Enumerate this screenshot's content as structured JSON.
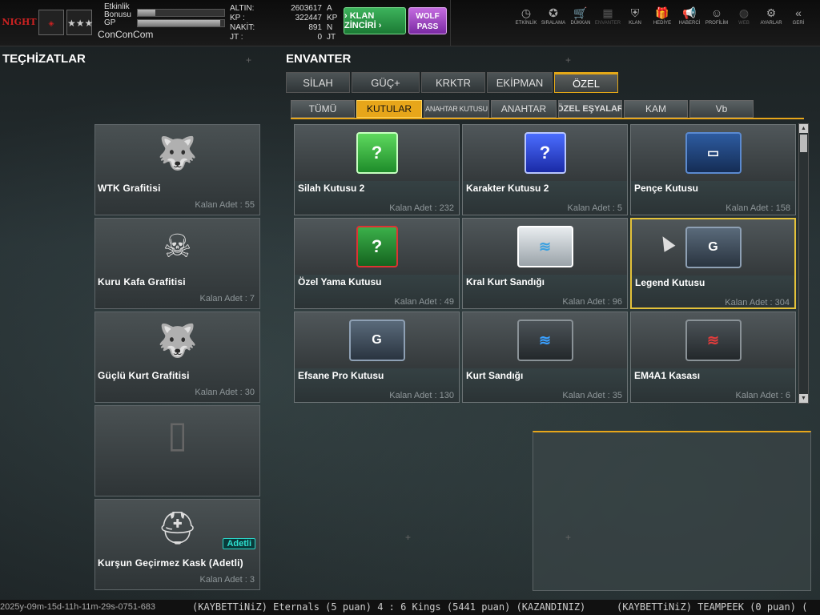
{
  "header": {
    "logo_text": "NIGHT",
    "rank_badge": "rank-stars-icon",
    "xp_labels": [
      "Etkinlik",
      "Bonusu",
      "GP"
    ],
    "etkinlik_progress": 0.2,
    "gp_progress": 0.95,
    "nickname": "ConConCom",
    "currency": [
      {
        "label": "ALTIN:",
        "value": "2603617",
        "unit": "A"
      },
      {
        "label": "KP :",
        "value": "322447",
        "unit": "KP"
      },
      {
        "label": "NAKİT:",
        "value": "891",
        "unit": "N"
      },
      {
        "label": "JT :",
        "value": "0",
        "unit": "JT"
      }
    ],
    "klan_button": "› KLAN ZİNCİRİ ›",
    "wolf_pass_line1": "WOLF",
    "wolf_pass_line2": "PASS",
    "menu": [
      {
        "label": "ETKİNLİK",
        "icon": "stopwatch-icon",
        "glyph": "◷",
        "enabled": true
      },
      {
        "label": "SIRALAMA",
        "icon": "medal-icon",
        "glyph": "✪",
        "enabled": true
      },
      {
        "label": "DÜKKAN",
        "icon": "cart-icon",
        "glyph": "🛒",
        "enabled": true
      },
      {
        "label": "ENVANTER",
        "icon": "inventory-icon",
        "glyph": "▦",
        "enabled": false
      },
      {
        "label": "KLAN",
        "icon": "shield-icon",
        "glyph": "⛨",
        "enabled": true
      },
      {
        "label": "HEDİYE",
        "icon": "gift-icon",
        "glyph": "🎁",
        "enabled": true
      },
      {
        "label": "HABERCİ",
        "icon": "megaphone-icon",
        "glyph": "📢",
        "enabled": true
      },
      {
        "label": "PROFİLİM",
        "icon": "profile-icon",
        "glyph": "☺",
        "enabled": true
      },
      {
        "label": "WEB",
        "icon": "globe-icon",
        "glyph": "◍",
        "enabled": false
      },
      {
        "label": "AYARLAR",
        "icon": "gear-icon",
        "glyph": "⚙",
        "enabled": true
      },
      {
        "label": "GERİ",
        "icon": "back-arrow-icon",
        "glyph": "«",
        "enabled": true
      }
    ]
  },
  "left": {
    "title": "TEÇHİZATLAR",
    "items": [
      {
        "name": "WTK Grafitisi",
        "count": "Kalan Adet : 55",
        "icon": "wolf-logo-icon",
        "glyph": "🐺"
      },
      {
        "name": "Kuru Kafa Grafitisi",
        "count": "Kalan Adet : 7",
        "icon": "skull-icon",
        "glyph": "☠"
      },
      {
        "name": "Güçlü Kurt Grafitisi",
        "count": "Kalan Adet : 30",
        "icon": "wolf-icon",
        "glyph": "🐺"
      },
      {
        "name": "",
        "count": "",
        "icon": "spray-can-icon",
        "glyph": "▯"
      },
      {
        "name": "Kurşun Geçirmez Kask (Adetli)",
        "count": "Kalan Adet : 3",
        "icon": "helmet-icon",
        "glyph": "⛑",
        "tag": "Adetli"
      }
    ]
  },
  "inventory": {
    "title": "ENVANTER",
    "tabs": [
      "SİLAH",
      "GÜÇ+",
      "KRKTR",
      "EKİPMAN",
      "ÖZEL"
    ],
    "active_tab": 4,
    "subtabs": [
      "TÜMÜ",
      "KUTULAR",
      "ANAHTAR KUTUSU",
      "ANAHTAR",
      "ÖZEL EŞYALAR",
      "KAM",
      "Vb"
    ],
    "active_subtab": 1,
    "items": [
      {
        "name": "Silah Kutusu 2",
        "count": "Kalan Adet : 232",
        "style": "g",
        "glyph": "?"
      },
      {
        "name": "Karakter Kutusu 2",
        "count": "Kalan Adet : 5",
        "style": "b",
        "glyph": "?"
      },
      {
        "name": "Pençe Kutusu",
        "count": "Kalan Adet : 158",
        "style": "blue",
        "glyph": "▭"
      },
      {
        "name": "Özel Yama Kutusu",
        "count": "Kalan Adet : 49",
        "style": "r",
        "glyph": "?"
      },
      {
        "name": "Kral Kurt Sandığı",
        "count": "Kalan Adet : 96",
        "style": "silver",
        "glyph": "≋"
      },
      {
        "name": "Legend Kutusu",
        "count": "Kalan Adet : 304",
        "style": "metal",
        "glyph": "G"
      },
      {
        "name": "Efsane Pro Kutusu",
        "count": "Kalan Adet : 130",
        "style": "metal",
        "glyph": "G"
      },
      {
        "name": "Kurt Sandığı",
        "count": "Kalan Adet : 35",
        "style": "darkblue",
        "glyph": "≋"
      },
      {
        "name": "EM4A1 Kasası",
        "count": "Kalan Adet : 6",
        "style": "darkred",
        "glyph": "≋"
      }
    ],
    "selected_item": 5
  },
  "ticker": {
    "timestamp": "2025y-09m-15d-11h-11m-29s-0751-683",
    "message": "(KAYBETTiNiZ) Eternals (5 puan) 4 : 6 Kings (5441 puan) (KAZANDINIZ)",
    "message2": "(KAYBETTiNiZ) TEAMPEEK (0 puan) ("
  }
}
